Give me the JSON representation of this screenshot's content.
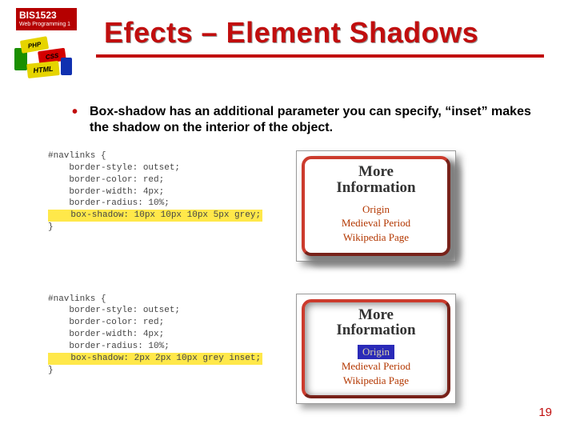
{
  "course": {
    "code": "BIS1523",
    "subtitle": "Web Programming 1"
  },
  "bricks": {
    "php": "PHP",
    "css": "CSS",
    "html": "HTML"
  },
  "title": "Efects – Element Shadows",
  "bullet": "Box-shadow has an additional parameter you can specify, “inset” makes the shadow on the interior of the object.",
  "code1": {
    "l1": "#navlinks {",
    "l2": "    border-style: outset;",
    "l3": "    border-color: red;",
    "l4": "    border-width: 4px;",
    "l5": "    border-radius: 10%;",
    "hl": "    box-shadow: 10px 10px 10px 5px grey;",
    "l6": "}"
  },
  "code2": {
    "l1": "#navlinks {",
    "l2": "    border-style: outset;",
    "l3": "    border-color: red;",
    "l4": "    border-width: 4px;",
    "l5": "    border-radius: 10%;",
    "hl": "    box-shadow: 2px 2px 10px grey inset;",
    "l6": "}"
  },
  "card": {
    "heading_l1": "More",
    "heading_l2": "Information",
    "link1": "Origin",
    "link2": "Medieval Period",
    "link3": "Wikipedia Page"
  },
  "page": "19"
}
